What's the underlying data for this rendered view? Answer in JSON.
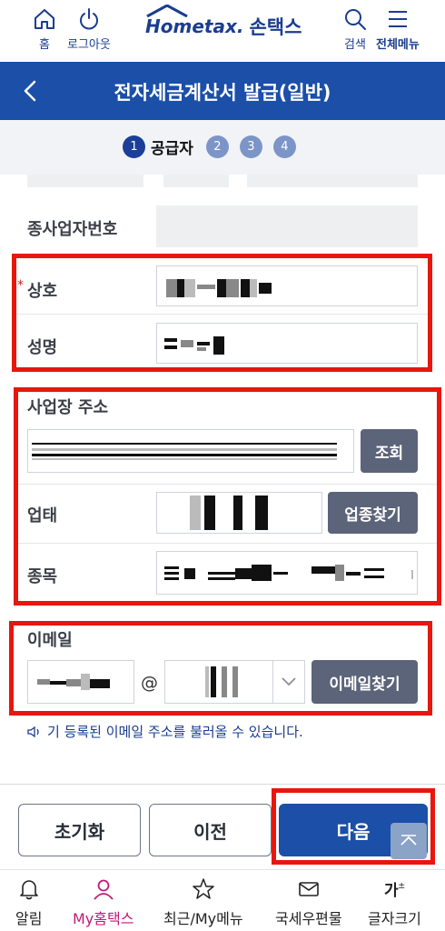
{
  "header": {
    "home_label": "홈",
    "logout_label": "로그아웃",
    "logo_text": "Hometax.",
    "logo_korean": "손택스",
    "search_label": "검색",
    "menu_label": "전체메뉴"
  },
  "title_bar": {
    "title": "전자세금계산서 발급(일반)"
  },
  "steps": {
    "current_number": "1",
    "current_label": "공급자",
    "others": [
      "2",
      "3",
      "4"
    ]
  },
  "form": {
    "sub_business_label": "종사업자번호",
    "company_name_label": "상호",
    "required_mark": "*",
    "ceo_name_label": "성명",
    "address_label": "사업장 주소",
    "address_search_button": "조회",
    "business_type_label": "업태",
    "business_type_button": "업종찾기",
    "business_item_label": "종목",
    "email_label": "이메일",
    "email_at": "@",
    "email_search_button": "이메일찾기",
    "email_hint": "기 등록된 이메일 주소를 불러올 수 있습니다."
  },
  "actions": {
    "reset_label": "초기화",
    "prev_label": "이전",
    "next_label": "다음"
  },
  "tabbar": {
    "items": [
      {
        "label": "알림",
        "icon": "bell-icon"
      },
      {
        "label": "My홈택스",
        "icon": "person-icon"
      },
      {
        "label": "최근/My메뉴",
        "icon": "star-icon"
      },
      {
        "label": "국세우편물",
        "icon": "mail-icon"
      },
      {
        "label": "글자크기",
        "icon": "font-size-icon"
      }
    ]
  },
  "colors": {
    "primary": "#1b4fa8",
    "highlight": "#e8160d",
    "active_tab": "#c21a77"
  }
}
